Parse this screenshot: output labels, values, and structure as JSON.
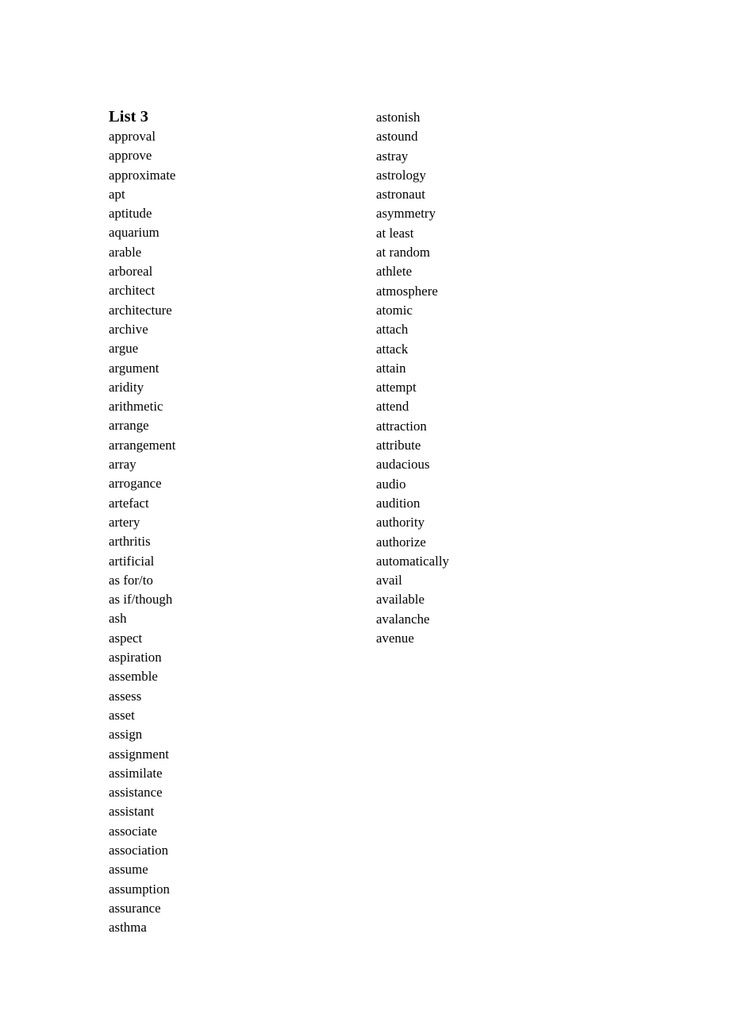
{
  "document": {
    "title": "List 3",
    "background_color": "#ffffff",
    "text_color": "#000000"
  },
  "columns": {
    "left": {
      "name": "left-word-column",
      "words": [
        "approval",
        "approve",
        "approximate",
        "apt",
        "aptitude",
        "aquarium",
        "arable",
        "arboreal",
        "architect",
        "architecture",
        "archive",
        "argue",
        "argument",
        "aridity",
        "arithmetic",
        "arrange",
        "arrangement",
        "array",
        "arrogance",
        "artefact",
        "artery",
        "arthritis",
        "artificial",
        "as for/to",
        "as if/though",
        "ash",
        "aspect",
        "aspiration",
        "assemble",
        "assess",
        "asset",
        "assign",
        "assignment",
        "assimilate",
        "assistance",
        "assistant",
        "associate",
        "association",
        "assume",
        "assumption",
        "assurance",
        "asthma"
      ]
    },
    "right": {
      "name": "right-word-column",
      "words": [
        "astonish",
        "astound",
        "astray",
        "astrology",
        "astronaut",
        "asymmetry",
        "at least",
        "at random",
        "athlete",
        "atmosphere",
        "atomic",
        "attach",
        "attack",
        "attain",
        "attempt",
        "attend",
        "attraction",
        "attribute",
        "audacious",
        "audio",
        "audition",
        "authority",
        "authorize",
        "automatically",
        "avail",
        "available",
        "avalanche",
        "avenue"
      ]
    }
  }
}
